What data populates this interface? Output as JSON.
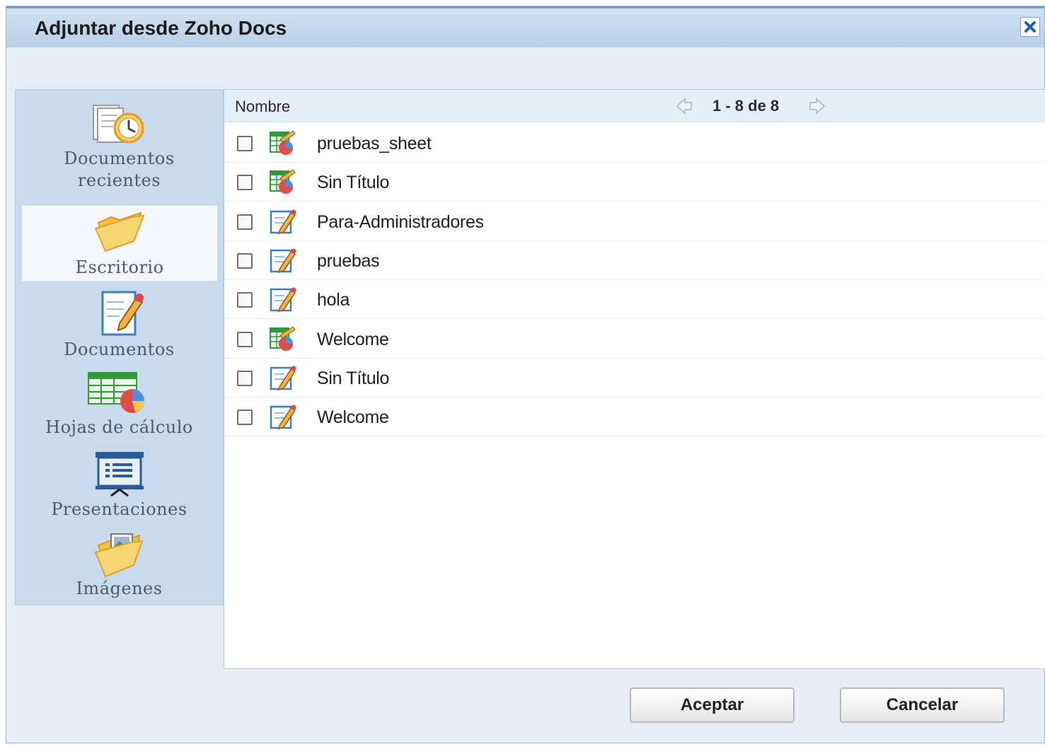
{
  "dialog": {
    "title": "Adjuntar desde Zoho Docs"
  },
  "sidebar": {
    "items": [
      {
        "label": "Documentos\nrecientes",
        "icon": "recent-documents-icon"
      },
      {
        "label": "Escritorio",
        "icon": "folder-icon",
        "active": true
      },
      {
        "label": "Documentos",
        "icon": "document-icon"
      },
      {
        "label": "Hojas de cálculo",
        "icon": "spreadsheet-icon"
      },
      {
        "label": "Presentaciones",
        "icon": "presentation-icon"
      },
      {
        "label": "Imágenes",
        "icon": "images-folder-icon"
      }
    ]
  },
  "list": {
    "column_name": "Nombre",
    "pagination": "1 - 8 de 8",
    "files": [
      {
        "name": "pruebas_sheet",
        "type": "spreadsheet"
      },
      {
        "name": "Sin Título",
        "type": "spreadsheet"
      },
      {
        "name": "Para-Administradores",
        "type": "document"
      },
      {
        "name": "pruebas",
        "type": "document"
      },
      {
        "name": "hola",
        "type": "document"
      },
      {
        "name": "Welcome",
        "type": "spreadsheet"
      },
      {
        "name": "Sin Título",
        "type": "document"
      },
      {
        "name": "Welcome",
        "type": "document"
      }
    ]
  },
  "buttons": {
    "accept": "Aceptar",
    "cancel": "Cancelar"
  }
}
